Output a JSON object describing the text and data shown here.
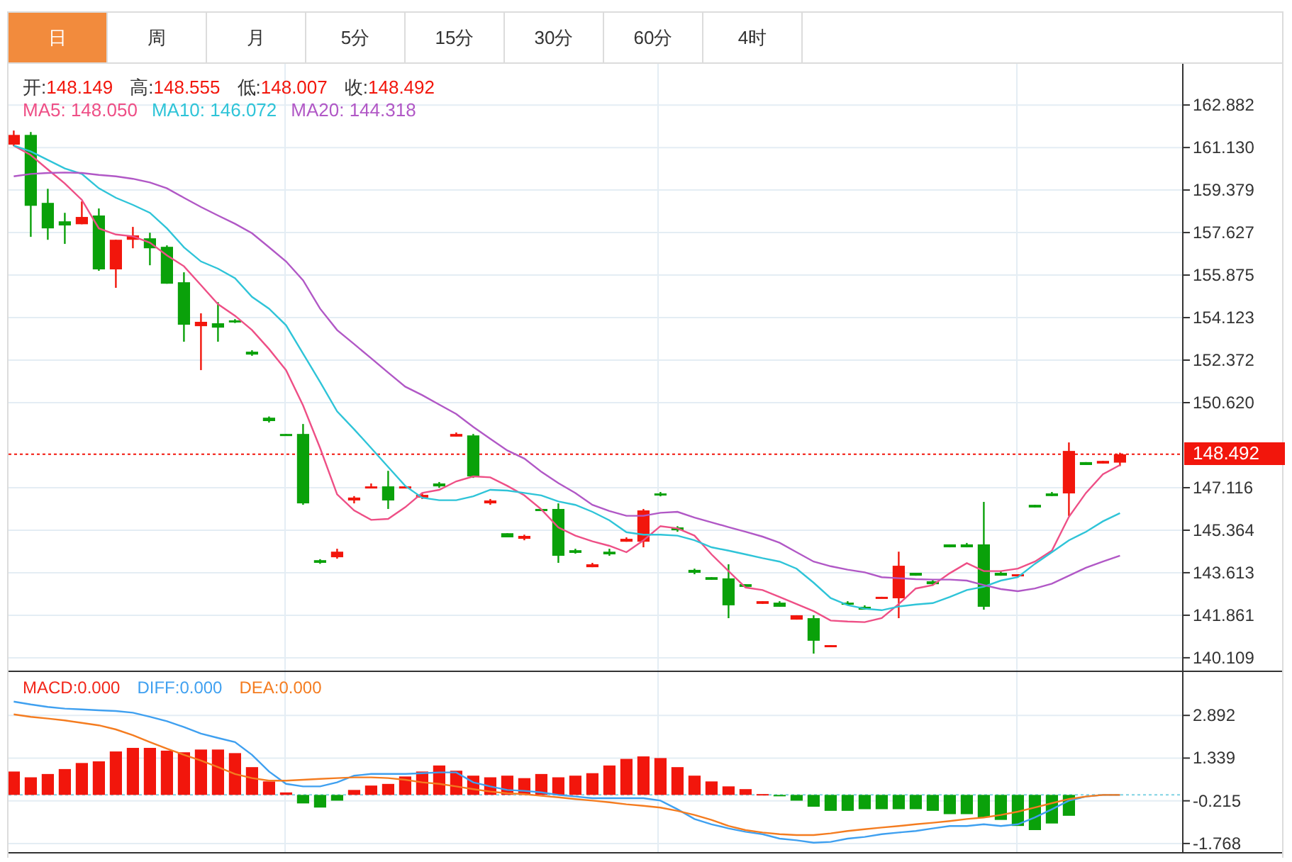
{
  "tabs": [
    {
      "label": "日",
      "selected": true
    },
    {
      "label": "周",
      "selected": false
    },
    {
      "label": "月",
      "selected": false
    },
    {
      "label": "5分",
      "selected": false
    },
    {
      "label": "15分",
      "selected": false
    },
    {
      "label": "30分",
      "selected": false
    },
    {
      "label": "60分",
      "selected": false
    },
    {
      "label": "4时",
      "selected": false
    }
  ],
  "price_chart": {
    "legend_ohlc": [
      {
        "label": "开:",
        "value": "148.149"
      },
      {
        "label": "高:",
        "value": "148.555"
      },
      {
        "label": "低:",
        "value": "148.007"
      },
      {
        "label": "收:",
        "value": "148.492"
      }
    ],
    "legend_ma": [
      {
        "text": "MA5: 148.050",
        "color": "#ee4f86"
      },
      {
        "text": "MA10: 146.072",
        "color": "#2fc4d8"
      },
      {
        "text": "MA20: 144.318",
        "color": "#b158c6"
      }
    ],
    "chart_data": {
      "type": "candlestick",
      "grid": true,
      "ylim": [
        139.58,
        164.58
      ],
      "yticks": [
        162.882,
        {
          "value": 161.13,
          "label": "161.130"
        },
        159.379,
        157.627,
        155.875,
        154.123,
        152.372,
        {
          "value": 150.62,
          "label": "150.620"
        },
        147.116,
        145.364,
        143.613,
        141.861,
        140.109
      ],
      "ref_lines": [
        {
          "axis": "y",
          "value": 148.492,
          "label": "148.492",
          "color": "#f2160c"
        }
      ],
      "ohlc": [
        [
          161.25,
          161.83,
          161.19,
          161.65
        ],
        [
          161.65,
          161.77,
          157.45,
          158.73
        ],
        [
          158.85,
          159.43,
          157.33,
          157.8
        ],
        [
          158.09,
          158.44,
          157.16,
          157.92
        ],
        [
          157.97,
          158.91,
          157.97,
          158.27
        ],
        [
          158.33,
          158.62,
          156.05,
          156.11
        ],
        [
          156.11,
          157.33,
          155.35,
          157.33
        ],
        [
          157.33,
          157.86,
          156.98,
          157.51
        ],
        [
          157.39,
          157.62,
          156.28,
          156.98
        ],
        [
          157.04,
          157.1,
          155.52,
          155.52
        ],
        [
          155.58,
          155.99,
          153.13,
          153.83
        ],
        [
          153.77,
          154.3,
          151.96,
          153.95
        ],
        [
          153.89,
          154.76,
          153.13,
          153.71
        ],
        [
          154.01,
          154.06,
          153.9,
          153.95
        ],
        [
          152.72,
          152.78,
          152.55,
          152.6
        ],
        [
          150.0,
          150.05,
          149.8,
          149.86
        ],
        [
          149.33,
          149.33,
          149.27,
          149.27
        ],
        [
          149.33,
          149.74,
          146.41,
          146.47
        ],
        [
          144.13,
          144.17,
          143.98,
          144.02
        ],
        [
          144.25,
          144.6,
          144.19,
          144.48
        ],
        [
          146.59,
          146.77,
          146.47,
          146.71
        ],
        [
          147.11,
          147.29,
          147.11,
          147.17
        ],
        [
          147.17,
          147.81,
          146.24,
          146.59
        ],
        [
          147.11,
          147.17,
          147.11,
          147.17
        ],
        [
          146.71,
          146.88,
          146.65,
          146.82
        ],
        [
          147.29,
          147.35,
          147.11,
          147.17
        ],
        [
          149.22,
          149.39,
          149.22,
          149.33
        ],
        [
          149.27,
          149.33,
          147.52,
          147.58
        ],
        [
          146.47,
          146.65,
          146.41,
          146.59
        ],
        [
          145.24,
          145.24,
          145.07,
          145.07
        ],
        [
          145.01,
          145.18,
          144.95,
          145.13
        ],
        [
          146.24,
          146.24,
          146.18,
          146.18
        ],
        [
          146.24,
          146.47,
          144.02,
          144.31
        ],
        [
          144.54,
          144.6,
          144.4,
          144.43
        ],
        [
          143.84,
          144.02,
          143.84,
          143.96
        ],
        [
          144.48,
          144.6,
          144.31,
          144.37
        ],
        [
          144.89,
          145.07,
          144.89,
          145.01
        ],
        [
          144.89,
          146.24,
          144.66,
          146.18
        ],
        [
          146.88,
          146.94,
          146.76,
          146.82
        ],
        [
          145.48,
          145.53,
          145.3,
          145.36
        ],
        [
          143.73,
          143.78,
          143.55,
          143.61
        ],
        [
          143.43,
          143.43,
          143.32,
          143.32
        ],
        [
          143.38,
          143.96,
          141.74,
          142.27
        ],
        [
          143.14,
          143.14,
          143.03,
          143.03
        ],
        [
          142.33,
          142.44,
          142.33,
          142.44
        ],
        [
          142.38,
          142.44,
          142.21,
          142.21
        ],
        [
          141.68,
          141.86,
          141.68,
          141.86
        ],
        [
          141.74,
          141.86,
          140.28,
          140.81
        ],
        [
          140.57,
          140.63,
          140.57,
          140.63
        ],
        [
          142.38,
          142.44,
          142.33,
          142.33
        ],
        [
          142.21,
          142.27,
          142.09,
          142.09
        ],
        [
          142.56,
          142.62,
          142.56,
          142.62
        ],
        [
          142.56,
          144.48,
          141.74,
          143.9
        ],
        [
          143.61,
          143.61,
          143.49,
          143.49
        ],
        [
          143.26,
          143.32,
          143.08,
          143.14
        ],
        [
          144.78,
          144.78,
          144.66,
          144.66
        ],
        [
          144.78,
          144.84,
          144.66,
          144.66
        ],
        [
          144.78,
          146.53,
          142.09,
          142.21
        ],
        [
          143.61,
          143.67,
          143.49,
          143.49
        ],
        [
          143.49,
          143.55,
          143.43,
          143.55
        ],
        [
          146.41,
          146.41,
          146.3,
          146.3
        ],
        [
          146.88,
          146.94,
          146.77,
          146.77
        ],
        [
          146.88,
          148.98,
          145.95,
          148.63
        ],
        [
          148.17,
          148.17,
          148.05,
          148.05
        ],
        [
          148.11,
          148.22,
          148.11,
          148.22
        ],
        [
          148.149,
          148.555,
          148.007,
          148.492
        ]
      ],
      "series": [
        {
          "type": "line",
          "color": "#ee4f86",
          "values": [
            161.21,
            160.82,
            160.23,
            159.65,
            158.97,
            157.8,
            157.55,
            157.47,
            157.21,
            156.69,
            156.24,
            155.46,
            154.68,
            154.2,
            153.61,
            152.83,
            151.96,
            150.5,
            148.75,
            146.84,
            146.18,
            145.79,
            145.83,
            146.31,
            146.9,
            147.03,
            147.38,
            147.58,
            147.54,
            147.19,
            146.8,
            146.22,
            145.48,
            145.14,
            144.91,
            144.72,
            144.46,
            144.95,
            145.53,
            145.44,
            145.14,
            144.37,
            143.68,
            143.0,
            142.9,
            142.61,
            142.32,
            142.03,
            141.64,
            141.6,
            141.58,
            141.74,
            142.32,
            142.96,
            143.1,
            143.59,
            144.01,
            143.68,
            143.68,
            143.78,
            144.07,
            144.52,
            145.92,
            146.9,
            147.67,
            148.05
          ]
        },
        {
          "type": "line",
          "color": "#2fc4d8",
          "values": [
            161.21,
            160.97,
            160.62,
            160.27,
            160.04,
            159.45,
            159.06,
            158.77,
            158.44,
            157.8,
            157.02,
            156.44,
            156.14,
            155.75,
            154.98,
            154.49,
            153.81,
            152.64,
            151.47,
            150.26,
            149.52,
            148.75,
            147.97,
            147.19,
            146.7,
            146.6,
            146.6,
            146.76,
            147.03,
            147.0,
            146.9,
            146.8,
            146.55,
            146.41,
            146.12,
            145.77,
            145.28,
            145.18,
            145.18,
            145.14,
            144.95,
            144.66,
            144.52,
            144.37,
            144.21,
            144.07,
            143.78,
            143.2,
            142.57,
            142.28,
            142.13,
            142.07,
            142.22,
            142.3,
            142.36,
            142.61,
            142.9,
            143.04,
            143.29,
            143.43,
            143.98,
            144.46,
            144.95,
            145.3,
            145.73,
            146.07
          ]
        },
        {
          "type": "line",
          "color": "#b158c6",
          "values": [
            159.94,
            160.04,
            160.08,
            160.1,
            160.08,
            160.0,
            159.94,
            159.84,
            159.69,
            159.45,
            159.06,
            158.68,
            158.33,
            157.99,
            157.6,
            157.02,
            156.44,
            155.66,
            154.49,
            153.61,
            153.03,
            152.45,
            151.86,
            151.28,
            150.93,
            150.54,
            150.15,
            149.62,
            149.13,
            148.65,
            148.32,
            147.77,
            147.3,
            146.9,
            146.41,
            146.16,
            145.96,
            145.96,
            146.08,
            146.12,
            145.88,
            145.69,
            145.49,
            145.3,
            145.1,
            144.85,
            144.46,
            144.07,
            143.88,
            143.74,
            143.63,
            143.43,
            143.39,
            143.35,
            143.33,
            143.33,
            143.29,
            143.1,
            142.94,
            142.85,
            142.96,
            143.16,
            143.49,
            143.82,
            144.07,
            144.32
          ]
        }
      ]
    }
  },
  "macd_chart": {
    "legend": [
      {
        "text": "MACD:0.000",
        "color": "#f2261a"
      },
      {
        "text": "DIFF:0.000",
        "color": "#3fa0f0"
      },
      {
        "text": "DEA:0.000",
        "color": "#f47c20"
      }
    ],
    "chart_data": {
      "type": "bar",
      "grid": true,
      "ylim": [
        -2.08,
        4.47
      ],
      "yticks": [
        2.892,
        1.339,
        -0.215,
        -1.768
      ],
      "ref_lines": [
        {
          "axis": "y",
          "value": 0,
          "color": "#7fd3e3"
        }
      ],
      "series": [
        {
          "type": "bar",
          "color": "#f2160c",
          "values": [
            0.85,
            0.64,
            0.76,
            0.94,
            1.16,
            1.22,
            1.58,
            1.71,
            1.71,
            1.61,
            1.55,
            1.65,
            1.65,
            1.52,
            1.01,
            0.49,
            0.09,
            null,
            null,
            null,
            0.18,
            0.34,
            0.4,
            0.67,
            0.85,
            1.07,
            0.88,
            0.7,
            0.64,
            0.7,
            0.61,
            0.76,
            0.64,
            0.7,
            0.79,
            1.07,
            1.31,
            1.4,
            1.34,
            1.01,
            0.7,
            0.49,
            0.31,
            0.21,
            0.03,
            null,
            null,
            null,
            null,
            null,
            null,
            null,
            null,
            null,
            null,
            null,
            null,
            null,
            null,
            null,
            null,
            null,
            null,
            null,
            null,
            null
          ]
        },
        {
          "type": "bar",
          "color": "#0aa10a",
          "values": [
            null,
            null,
            null,
            null,
            null,
            null,
            null,
            null,
            null,
            null,
            null,
            null,
            null,
            null,
            null,
            null,
            null,
            -0.31,
            -0.46,
            -0.21,
            null,
            null,
            null,
            null,
            null,
            null,
            null,
            null,
            null,
            null,
            null,
            null,
            null,
            null,
            null,
            null,
            null,
            null,
            null,
            null,
            null,
            null,
            null,
            null,
            null,
            -0.03,
            -0.21,
            -0.43,
            -0.58,
            -0.58,
            -0.52,
            -0.52,
            -0.52,
            -0.52,
            -0.58,
            -0.7,
            -0.7,
            -0.82,
            -0.91,
            -1.13,
            -1.28,
            -1.04,
            -0.76,
            null,
            null,
            null
          ]
        },
        {
          "type": "line",
          "color": "#3fa0f0",
          "values": [
            3.39,
            3.29,
            3.2,
            3.14,
            3.11,
            3.08,
            3.05,
            2.99,
            2.84,
            2.68,
            2.47,
            2.23,
            2.07,
            1.92,
            1.46,
            0.85,
            0.4,
            0.31,
            0.31,
            0.46,
            0.7,
            0.76,
            0.76,
            0.76,
            0.79,
            0.82,
            0.82,
            0.46,
            0.31,
            0.18,
            0.15,
            0.09,
            0,
            -0.06,
            -0.12,
            -0.12,
            -0.12,
            -0.12,
            -0.21,
            -0.52,
            -0.88,
            -1.07,
            -1.22,
            -1.34,
            -1.43,
            -1.59,
            -1.65,
            -1.74,
            -1.71,
            -1.59,
            -1.53,
            -1.43,
            -1.37,
            -1.31,
            -1.22,
            -1.13,
            -1.13,
            -1.07,
            -1.13,
            -1.07,
            -0.82,
            -0.52,
            -0.21,
            -0.06,
            0,
            0
          ]
        },
        {
          "type": "line",
          "color": "#f47c20",
          "values": [
            2.93,
            2.84,
            2.78,
            2.71,
            2.62,
            2.53,
            2.38,
            2.17,
            1.92,
            1.68,
            1.46,
            1.25,
            1.01,
            0.76,
            0.61,
            0.52,
            0.52,
            0.55,
            0.58,
            0.61,
            0.64,
            0.64,
            0.61,
            0.55,
            0.46,
            0.4,
            0.31,
            0.21,
            0.12,
            0.06,
            0.03,
            -0.03,
            -0.09,
            -0.15,
            -0.21,
            -0.27,
            -0.34,
            -0.4,
            -0.46,
            -0.58,
            -0.73,
            -0.91,
            -1.13,
            -1.28,
            -1.37,
            -1.43,
            -1.46,
            -1.46,
            -1.4,
            -1.31,
            -1.25,
            -1.19,
            -1.13,
            -1.07,
            -1.01,
            -0.95,
            -0.88,
            -0.82,
            -0.73,
            -0.61,
            -0.46,
            -0.3,
            -0.15,
            -0.06,
            0,
            0
          ]
        }
      ]
    }
  }
}
